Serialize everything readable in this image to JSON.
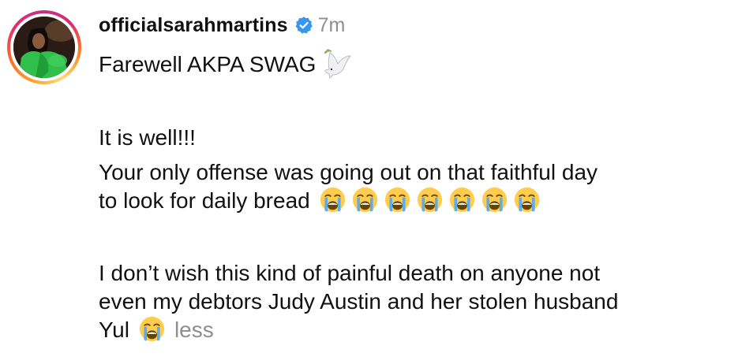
{
  "post": {
    "username": "officialsarahmartins",
    "time": "7m",
    "line1": "Farewell AKPA SWAG",
    "line2": "It is well!!!",
    "line3a": "Your only offense was going out on that faithful day",
    "line3b": "to look for daily bread",
    "line4a": "I don’t wish this kind of painful death on anyone not",
    "line4b": "even my debtors Judy Austin and her stolen husband",
    "line4c": "Yul",
    "less_label": "less"
  },
  "icons": {
    "verified": "verified-badge-icon",
    "dove": "dove-emoji",
    "crying": "loudly-crying-face-emoji"
  },
  "colors": {
    "verified_blue": "#3797f0",
    "muted_text": "#8e8e8e",
    "text": "#111111"
  }
}
